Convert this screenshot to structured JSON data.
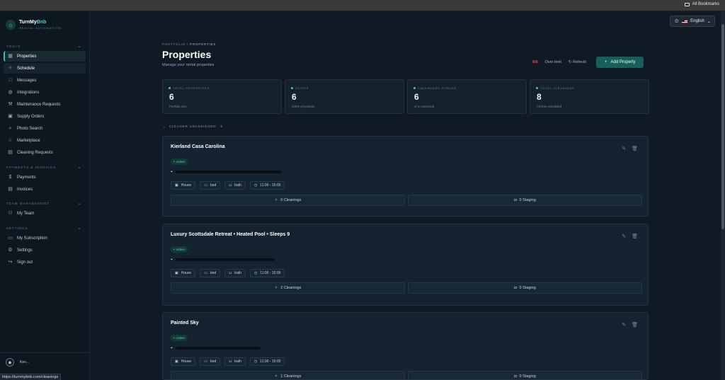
{
  "browser": {
    "bookmarks_label": "All Bookmarks",
    "status_url": "https://turnmybnb.com/cleanings"
  },
  "app": {
    "brand_part1": "TurnMy",
    "brand_part2": "Bnb",
    "brand_sub": "RENTAL AUTOMATION",
    "language": "English",
    "user_name": "Ken..."
  },
  "sidebar": {
    "tools_label": "TOOLS",
    "tools": [
      {
        "label": "Properties",
        "icon": "building-icon"
      },
      {
        "label": "Schedule",
        "icon": "sparkle-icon"
      },
      {
        "label": "Messages",
        "icon": "message-icon"
      },
      {
        "label": "Integrations",
        "icon": "globe-icon"
      },
      {
        "label": "Maintenance Requests",
        "icon": "wrench-icon"
      },
      {
        "label": "Supply Orders",
        "icon": "package-icon"
      },
      {
        "label": "Photo Search",
        "icon": "search-icon"
      },
      {
        "label": "Marketplace",
        "icon": "star-icon"
      },
      {
        "label": "Cleaning Requests",
        "icon": "clipboard-icon"
      }
    ],
    "payments_label": "PAYMENTS & INVOICES",
    "payments": [
      {
        "label": "Payments",
        "icon": "dollar-icon"
      },
      {
        "label": "Invoices",
        "icon": "invoice-icon"
      }
    ],
    "team_label": "TEAM MANAGEMENT",
    "team": [
      {
        "label": "My Team",
        "icon": "users-icon"
      }
    ],
    "settings_label": "SETTINGS",
    "settings": [
      {
        "label": "My Subscription",
        "icon": "card-icon"
      },
      {
        "label": "Settings",
        "icon": "gear-icon"
      },
      {
        "label": "Sign out",
        "icon": "sign-out-icon"
      }
    ]
  },
  "page": {
    "breadcrumb_part1": "PORTFOLIO",
    "breadcrumb_part2": "PROPERTIES",
    "title": "Properties",
    "subtitle": "Manage your rental properties",
    "limit": "6/6",
    "limit_label": "Over limit",
    "refresh_label": "Refresh",
    "add_label": "Add Property"
  },
  "stats": [
    {
      "label": "TOTAL PROPERTIES",
      "value": "6",
      "note": "Portfolio size"
    },
    {
      "label": "ACTIVE",
      "value": "6",
      "note": "100% of portfolio"
    },
    {
      "label": "CALENDARS SYNCED",
      "value": "6",
      "note": "of 6 connected"
    },
    {
      "label": "TOTAL CLEANINGS",
      "value": "8",
      "note": "All-time scheduled"
    }
  ],
  "cleaner": {
    "label": "CLEANER UNASSIGNED",
    "count": "6"
  },
  "properties": [
    {
      "title": "Kierland Casa Carolina",
      "status": "Active",
      "house": "House",
      "bed": "bed",
      "bath": "bath",
      "time": "11:00 - 15:00",
      "cleanings": "0 Cleanings",
      "staging": "0 Staging"
    },
    {
      "title": "Luxury Scottsdale Retreat • Heated Pool • Sleeps 9",
      "status": "Active",
      "house": "House",
      "bed": "bed",
      "bath": "bath",
      "time": "11:00 - 15:00",
      "cleanings": "2 Cleanings",
      "staging": "0 Staging"
    },
    {
      "title": "Painted Sky",
      "status": "Active",
      "house": "House",
      "bed": "bed",
      "bath": "bath",
      "time": "11:00 - 15:00",
      "cleanings": "1 Cleanings",
      "staging": "0 Staging"
    }
  ]
}
